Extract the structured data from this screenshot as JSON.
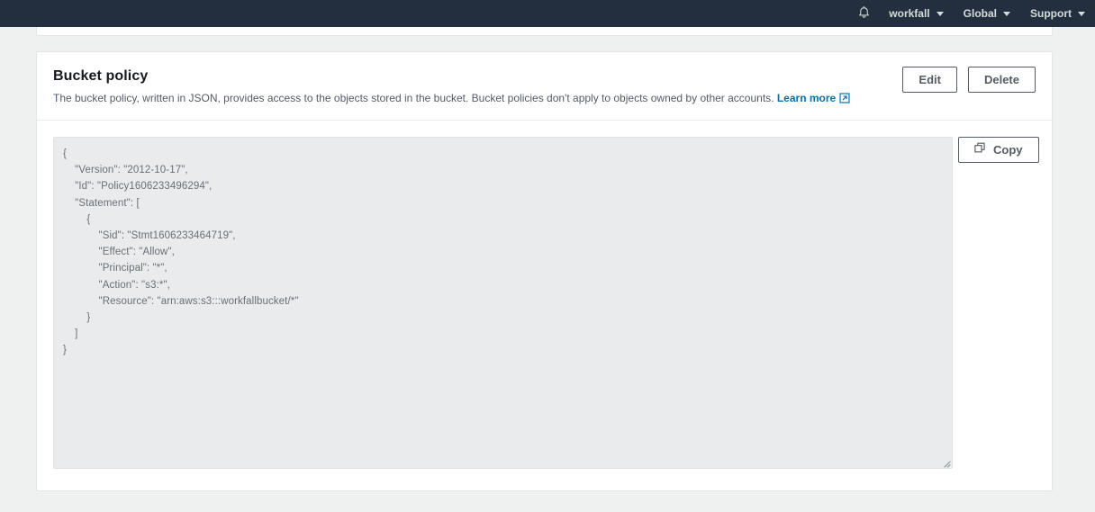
{
  "topnav": {
    "bell_icon": "bell-icon",
    "items": [
      {
        "label": "workfall",
        "icon": "chevron-down-icon"
      },
      {
        "label": "Global",
        "icon": "chevron-down-icon"
      },
      {
        "label": "Support",
        "icon": "chevron-down-icon"
      }
    ]
  },
  "card": {
    "title": "Bucket policy",
    "description": "The bucket policy, written in JSON, provides access to the objects stored in the bucket. Bucket policies don't apply to objects owned by other accounts.",
    "learn_more_label": "Learn more",
    "learn_more_icon": "external-link-icon",
    "edit_label": "Edit",
    "delete_label": "Delete",
    "copy_label": "Copy",
    "copy_icon": "copy-icon",
    "policy_json": "{\n    \"Version\": \"2012-10-17\",\n    \"Id\": \"Policy1606233496294\",\n    \"Statement\": [\n        {\n            \"Sid\": \"Stmt1606233464719\",\n            \"Effect\": \"Allow\",\n            \"Principal\": \"*\",\n            \"Action\": \"s3:*\",\n            \"Resource\": \"arn:aws:s3:::workfallbucket/*\"\n        }\n    ]\n}"
  },
  "colors": {
    "nav_background": "#232f3e",
    "page_background": "#eff0f0",
    "card_background": "#ffffff",
    "link": "#0073bb",
    "button_border": "#545b64",
    "code_background": "#e9ebed",
    "code_text": "#687078"
  }
}
